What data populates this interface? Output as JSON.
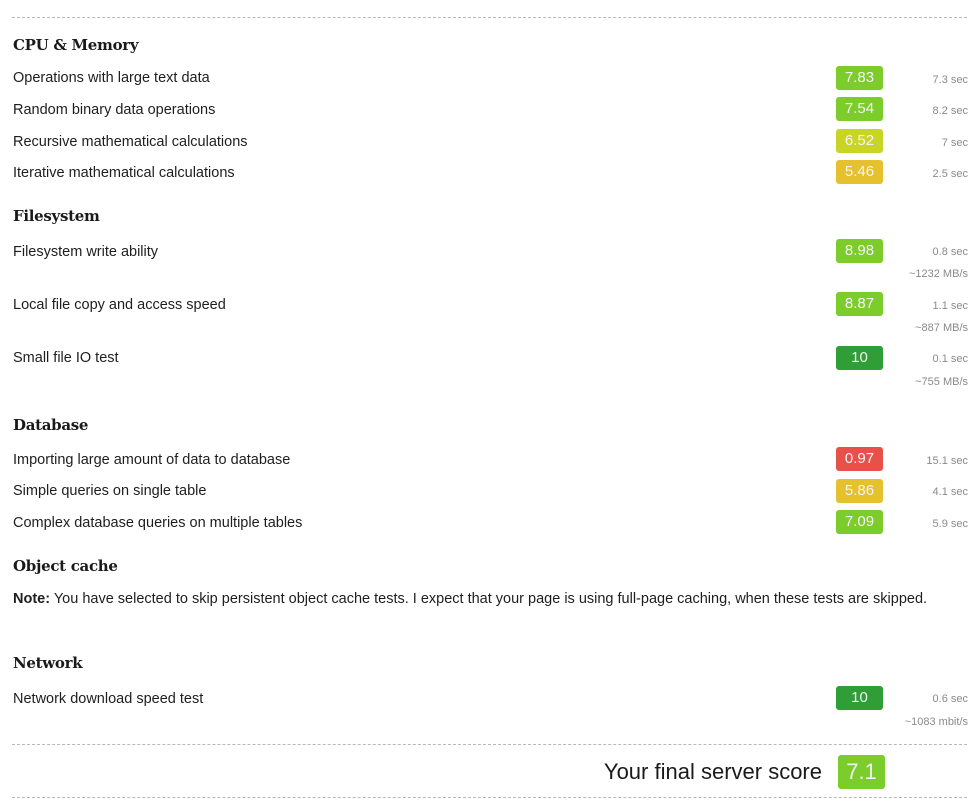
{
  "header_fragment": "(                              )",
  "colors": {
    "green_high": "#2f9e36",
    "green": "#7ccd2c",
    "yellow_green": "#c9d526",
    "yellow": "#e6c12e",
    "red": "#e8504a"
  },
  "sections": [
    {
      "title": "CPU & Memory",
      "tests": [
        {
          "label": "Operations with large text data",
          "score": "7.83",
          "time": "7.3 sec",
          "color": "#7ccd2c"
        },
        {
          "label": "Random binary data operations",
          "score": "7.54",
          "time": "8.2 sec",
          "color": "#7ccd2c"
        },
        {
          "label": "Recursive mathematical calculations",
          "score": "6.52",
          "time": "7 sec",
          "color": "#c9d526"
        },
        {
          "label": "Iterative mathematical calculations",
          "score": "5.46",
          "time": "2.5 sec",
          "color": "#e6c12e"
        }
      ]
    },
    {
      "title": "Filesystem",
      "tests": [
        {
          "label": "Filesystem write ability",
          "score": "8.98",
          "time": "0.8 sec",
          "speed": "~1232 MB/s",
          "color": "#7ccd2c"
        },
        {
          "label": "Local file copy and access speed",
          "score": "8.87",
          "time": "1.1 sec",
          "speed": "~887 MB/s",
          "color": "#7ccd2c"
        },
        {
          "label": "Small file IO test",
          "score": "10",
          "time": "0.1 sec",
          "speed": "~755 MB/s",
          "color": "#2f9e36"
        }
      ]
    },
    {
      "title": "Database",
      "tests": [
        {
          "label": "Importing large amount of data to database",
          "score": "0.97",
          "time": "15.1 sec",
          "color": "#e8504a"
        },
        {
          "label": "Simple queries on single table",
          "score": "5.86",
          "time": "4.1 sec",
          "color": "#e6c12e"
        },
        {
          "label": "Complex database queries on multiple tables",
          "score": "7.09",
          "time": "5.9 sec",
          "color": "#7ccd2c"
        }
      ]
    },
    {
      "title": "Object cache",
      "note_label": "Note:",
      "note_text": " You have selected to skip persistent object cache tests. I expect that your page is using full-page caching, when these tests are skipped."
    },
    {
      "title": "Network",
      "tests": [
        {
          "label": "Network download speed test",
          "score": "10",
          "time": "0.6 sec",
          "speed": "~1083 mbit/s",
          "color": "#2f9e36"
        }
      ]
    }
  ],
  "final": {
    "label": "Your final server score",
    "score": "7.1",
    "color": "#7ccd2c"
  }
}
